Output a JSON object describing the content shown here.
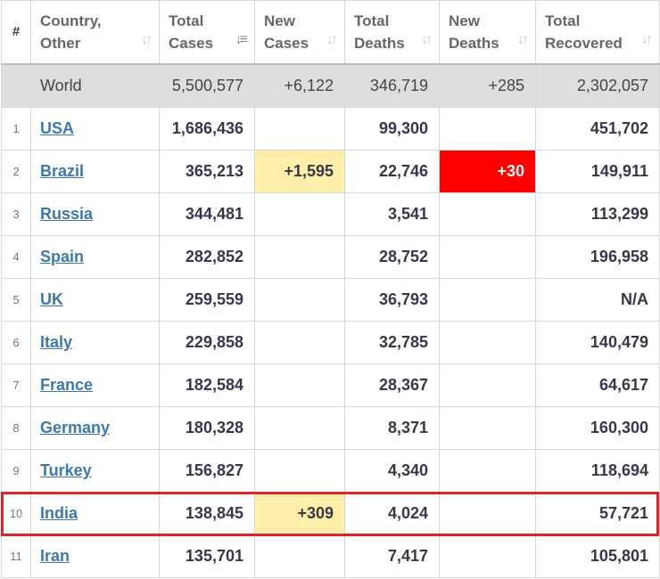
{
  "header": {
    "rank": "#",
    "country": [
      "Country,",
      "Other"
    ],
    "total_cases": [
      "Total",
      "Cases"
    ],
    "new_cases": [
      "New",
      "Cases"
    ],
    "total_deaths": [
      "Total",
      "Deaths"
    ],
    "new_deaths": [
      "New",
      "Deaths"
    ],
    "total_recovered": [
      "Total",
      "Recovered"
    ],
    "sort_icon": "sort-arrows-icon",
    "active_sort_column": "total_cases"
  },
  "world": {
    "label": "World",
    "total_cases": "5,500,577",
    "new_cases": "+6,122",
    "total_deaths": "346,719",
    "new_deaths": "+285",
    "total_recovered": "2,302,057"
  },
  "rows": [
    {
      "rank": "1",
      "country": "USA",
      "total_cases": "1,686,436",
      "new_cases": "",
      "total_deaths": "99,300",
      "new_deaths": "",
      "total_recovered": "451,702"
    },
    {
      "rank": "2",
      "country": "Brazil",
      "total_cases": "365,213",
      "new_cases": "+1,595",
      "total_deaths": "22,746",
      "new_deaths": "+30",
      "total_recovered": "149,911"
    },
    {
      "rank": "3",
      "country": "Russia",
      "total_cases": "344,481",
      "new_cases": "",
      "total_deaths": "3,541",
      "new_deaths": "",
      "total_recovered": "113,299"
    },
    {
      "rank": "4",
      "country": "Spain",
      "total_cases": "282,852",
      "new_cases": "",
      "total_deaths": "28,752",
      "new_deaths": "",
      "total_recovered": "196,958"
    },
    {
      "rank": "5",
      "country": "UK",
      "total_cases": "259,559",
      "new_cases": "",
      "total_deaths": "36,793",
      "new_deaths": "",
      "total_recovered": "N/A"
    },
    {
      "rank": "6",
      "country": "Italy",
      "total_cases": "229,858",
      "new_cases": "",
      "total_deaths": "32,785",
      "new_deaths": "",
      "total_recovered": "140,479"
    },
    {
      "rank": "7",
      "country": "France",
      "total_cases": "182,584",
      "new_cases": "",
      "total_deaths": "28,367",
      "new_deaths": "",
      "total_recovered": "64,617"
    },
    {
      "rank": "8",
      "country": "Germany",
      "total_cases": "180,328",
      "new_cases": "",
      "total_deaths": "8,371",
      "new_deaths": "",
      "total_recovered": "160,300"
    },
    {
      "rank": "9",
      "country": "Turkey",
      "total_cases": "156,827",
      "new_cases": "",
      "total_deaths": "4,340",
      "new_deaths": "",
      "total_recovered": "118,694"
    },
    {
      "rank": "10",
      "country": "India",
      "total_cases": "138,845",
      "new_cases": "+309",
      "total_deaths": "4,024",
      "new_deaths": "",
      "total_recovered": "57,721"
    },
    {
      "rank": "11",
      "country": "Iran",
      "total_cases": "135,701",
      "new_cases": "",
      "total_deaths": "7,417",
      "new_deaths": "",
      "total_recovered": "105,801"
    }
  ],
  "highlighted_row": "India",
  "colors": {
    "link": "#3f78a8",
    "new_cases_highlight": "#ffeeaa",
    "new_deaths_highlight": "#ff0000",
    "annotation_box": "#e0242a",
    "world_row_bg": "#dedede"
  }
}
